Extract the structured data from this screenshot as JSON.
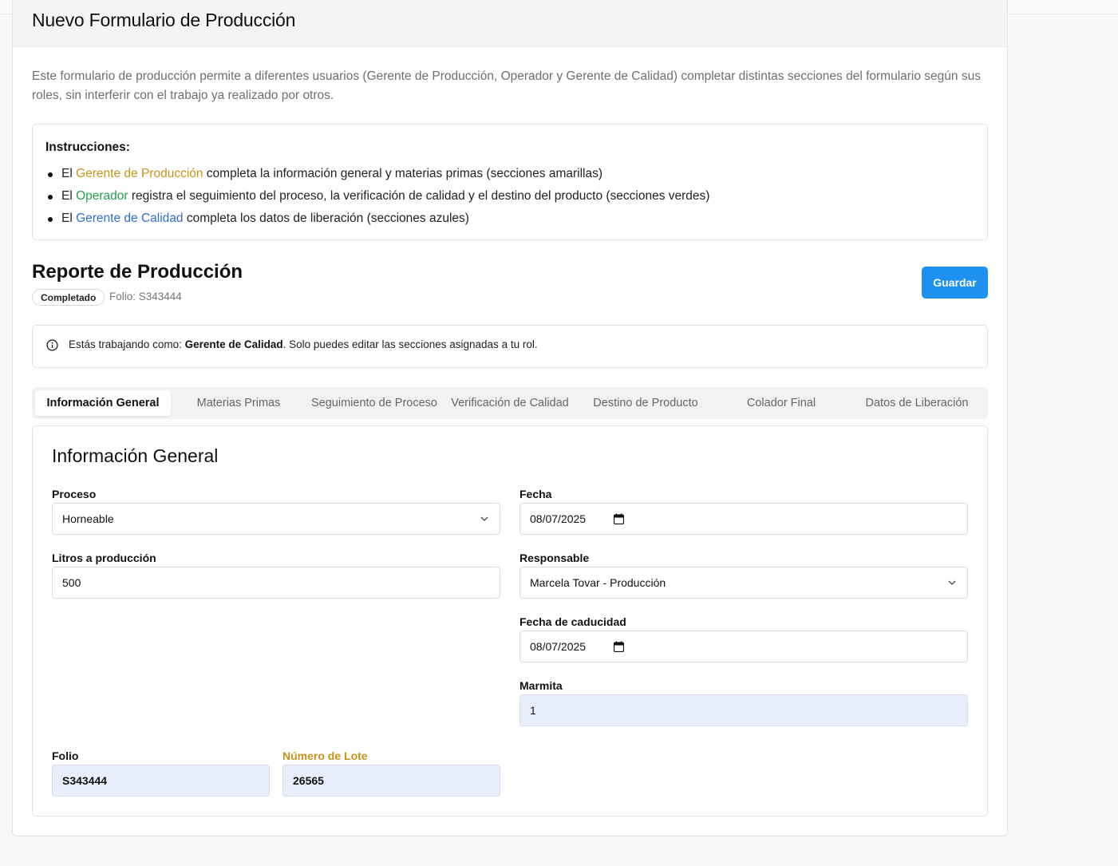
{
  "page": {
    "title": "Nuevo Formulario de Producción",
    "intro": "Este formulario de producción permite a diferentes usuarios (Gerente de Producción, Operador y Gerente de Calidad) completar distintas secciones del formulario según sus roles, sin interferir con el trabajo ya realizado por otros."
  },
  "instructions": {
    "title": "Instrucciones:",
    "items": [
      {
        "prefix": "El ",
        "role": "Gerente de Producción",
        "text": " completa la información general y materias primas (secciones amarillas)"
      },
      {
        "prefix": "El ",
        "role": "Operador",
        "text": " registra el seguimiento del proceso, la verificación de calidad y el destino del producto (secciones verdes)"
      },
      {
        "prefix": "El ",
        "role": "Gerente de Calidad",
        "text": " completa los datos de liberación (secciones azules)"
      }
    ]
  },
  "report": {
    "title": "Reporte de Producción",
    "status": "Completado",
    "folio": "Folio: S343444",
    "save_label": "Guardar"
  },
  "notice": {
    "prefix": "Estás trabajando como: ",
    "role": "Gerente de Calidad",
    "suffix": ". Solo puedes editar las secciones asignadas a tu rol."
  },
  "tabs": [
    {
      "label": "Información General",
      "active": true
    },
    {
      "label": "Materias Primas"
    },
    {
      "label": "Seguimiento de Proceso"
    },
    {
      "label": "Verificación de Calidad"
    },
    {
      "label": "Destino de Producto"
    },
    {
      "label": "Colador Final"
    },
    {
      "label": "Datos de Liberación"
    }
  ],
  "general": {
    "title": "Información General",
    "proceso": {
      "label": "Proceso",
      "value": "Horneable"
    },
    "fecha": {
      "label": "Fecha",
      "value": "08/07/2025"
    },
    "litros": {
      "label": "Litros a producción",
      "value": "500"
    },
    "responsable": {
      "label": "Responsable",
      "value": "Marcela Tovar - Producción"
    },
    "caducidad": {
      "label": "Fecha de caducidad",
      "value": "08/07/2025"
    },
    "marmita": {
      "label": "Marmita",
      "value": "1"
    },
    "folio": {
      "label": "Folio",
      "value": "S343444"
    },
    "lote": {
      "label": "Número de Lote",
      "value": "26565"
    }
  },
  "colors": {
    "accent": "#1e90f0",
    "production": "#c89418",
    "operator": "#23a14c",
    "quality": "#2f6fd6",
    "locked_field": "#e8eefb"
  }
}
